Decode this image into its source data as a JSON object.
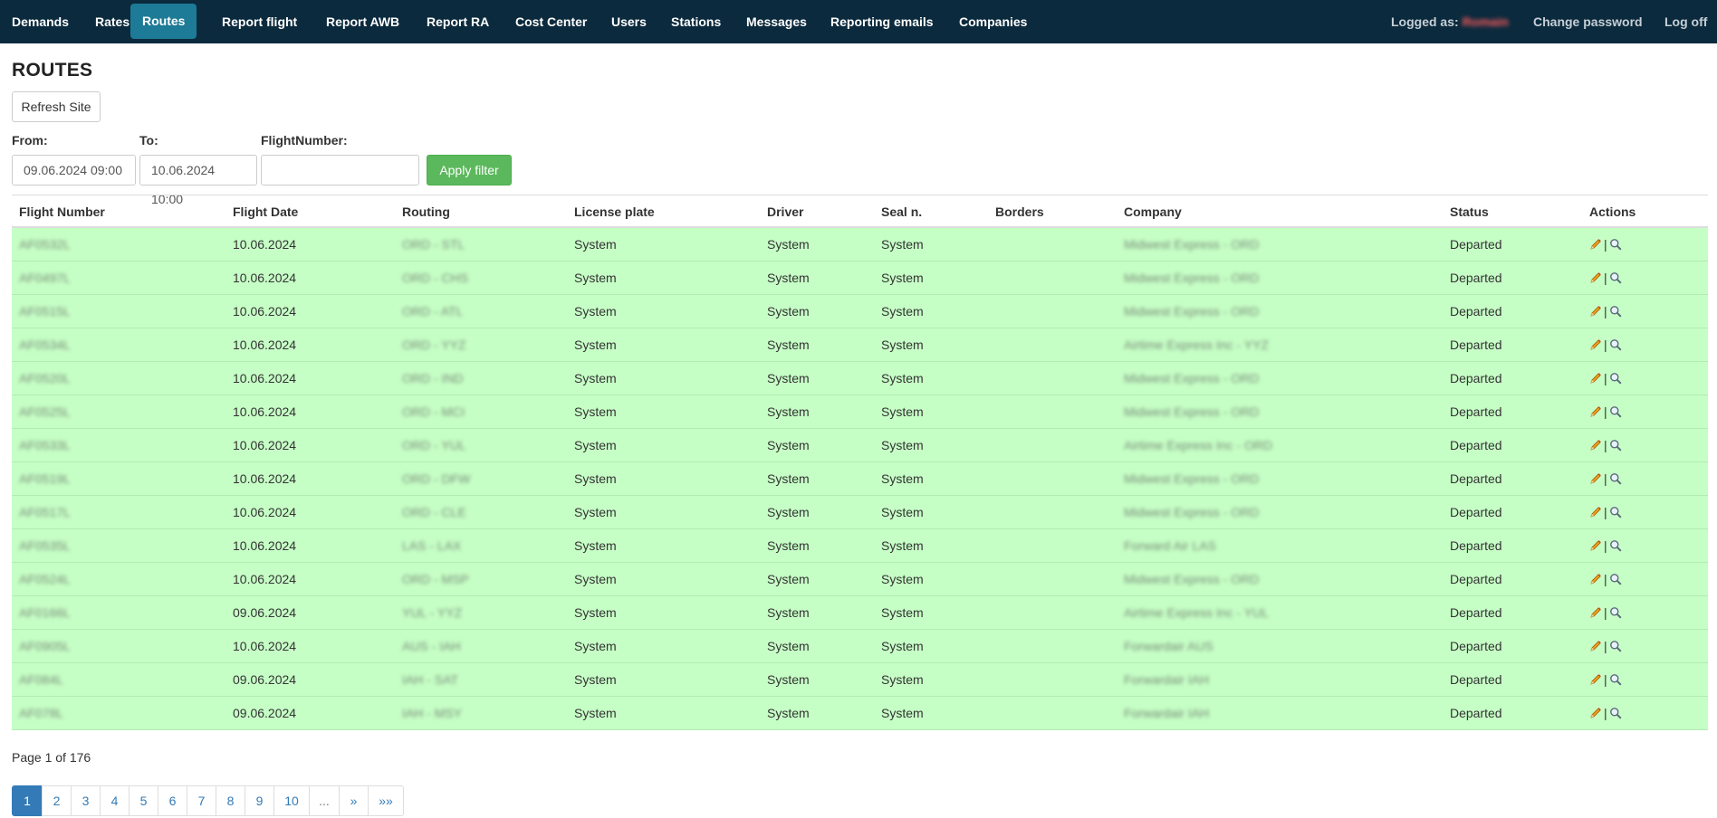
{
  "nav": {
    "items": [
      {
        "label": "Demands"
      },
      {
        "label": "Rates"
      },
      {
        "label": "Routes"
      },
      {
        "label": "Report flight"
      },
      {
        "label": "Report AWB"
      },
      {
        "label": "Report RA"
      },
      {
        "label": "Cost Center"
      },
      {
        "label": "Users"
      },
      {
        "label": "Stations"
      },
      {
        "label": "Messages"
      },
      {
        "label": "Reporting emails"
      },
      {
        "label": "Companies"
      }
    ],
    "active": "Routes",
    "logged_as_label": "Logged as:",
    "logged_user": "Romain",
    "change_password": "Change password",
    "log_off": "Log off"
  },
  "page": {
    "title": "ROUTES",
    "refresh_label": "Refresh Site"
  },
  "filter": {
    "from_label": "From:",
    "from_value": "09.06.2024 09:00",
    "to_label": "To:",
    "to_value": "10.06.2024 10:00",
    "flight_label": "FlightNumber:",
    "flight_value": "",
    "apply_label": "Apply filter"
  },
  "table": {
    "row_color": "#c6ffc6",
    "headers": [
      "Flight Number",
      "Flight Date",
      "Routing",
      "License plate",
      "Driver",
      "Seal n.",
      "Borders",
      "Company",
      "Status",
      "Actions"
    ],
    "rows": [
      {
        "flight": "AF0532L",
        "date": "10.06.2024",
        "routing": "ORD - STL",
        "plate": "System",
        "driver": "System",
        "seal": "System",
        "borders": "",
        "company": "Midwest Express - ORD",
        "status": "Departed"
      },
      {
        "flight": "AF0497L",
        "date": "10.06.2024",
        "routing": "ORD - CHS",
        "plate": "System",
        "driver": "System",
        "seal": "System",
        "borders": "",
        "company": "Midwest Express - ORD",
        "status": "Departed"
      },
      {
        "flight": "AF0515L",
        "date": "10.06.2024",
        "routing": "ORD - ATL",
        "plate": "System",
        "driver": "System",
        "seal": "System",
        "borders": "",
        "company": "Midwest Express - ORD",
        "status": "Departed"
      },
      {
        "flight": "AF0534L",
        "date": "10.06.2024",
        "routing": "ORD - YYZ",
        "plate": "System",
        "driver": "System",
        "seal": "System",
        "borders": "",
        "company": "Airtime Express Inc - YYZ",
        "status": "Departed"
      },
      {
        "flight": "AF0520L",
        "date": "10.06.2024",
        "routing": "ORD - IND",
        "plate": "System",
        "driver": "System",
        "seal": "System",
        "borders": "",
        "company": "Midwest Express - ORD",
        "status": "Departed"
      },
      {
        "flight": "AF0525L",
        "date": "10.06.2024",
        "routing": "ORD - MCI",
        "plate": "System",
        "driver": "System",
        "seal": "System",
        "borders": "",
        "company": "Midwest Express - ORD",
        "status": "Departed"
      },
      {
        "flight": "AF0533L",
        "date": "10.06.2024",
        "routing": "ORD - YUL",
        "plate": "System",
        "driver": "System",
        "seal": "System",
        "borders": "",
        "company": "Airtime Express Inc - ORD",
        "status": "Departed"
      },
      {
        "flight": "AF0519L",
        "date": "10.06.2024",
        "routing": "ORD - DFW",
        "plate": "System",
        "driver": "System",
        "seal": "System",
        "borders": "",
        "company": "Midwest Express - ORD",
        "status": "Departed"
      },
      {
        "flight": "AF0517L",
        "date": "10.06.2024",
        "routing": "ORD - CLE",
        "plate": "System",
        "driver": "System",
        "seal": "System",
        "borders": "",
        "company": "Midwest Express - ORD",
        "status": "Departed"
      },
      {
        "flight": "AF0535L",
        "date": "10.06.2024",
        "routing": "LAS - LAX",
        "plate": "System",
        "driver": "System",
        "seal": "System",
        "borders": "",
        "company": "Forward Air LAS",
        "status": "Departed"
      },
      {
        "flight": "AF0524L",
        "date": "10.06.2024",
        "routing": "ORD - MSP",
        "plate": "System",
        "driver": "System",
        "seal": "System",
        "borders": "",
        "company": "Midwest Express - ORD",
        "status": "Departed"
      },
      {
        "flight": "AF0166L",
        "date": "09.06.2024",
        "routing": "YUL - YYZ",
        "plate": "System",
        "driver": "System",
        "seal": "System",
        "borders": "",
        "company": "Airtime Express Inc - YUL",
        "status": "Departed"
      },
      {
        "flight": "AF0905L",
        "date": "10.06.2024",
        "routing": "AUS - IAH",
        "plate": "System",
        "driver": "System",
        "seal": "System",
        "borders": "",
        "company": "Forwardair AUS",
        "status": "Departed"
      },
      {
        "flight": "AF084L",
        "date": "09.06.2024",
        "routing": "IAH - SAT",
        "plate": "System",
        "driver": "System",
        "seal": "System",
        "borders": "",
        "company": "Forwardair IAH",
        "status": "Departed"
      },
      {
        "flight": "AF078L",
        "date": "09.06.2024",
        "routing": "IAH - MSY",
        "plate": "System",
        "driver": "System",
        "seal": "System",
        "borders": "",
        "company": "Forwardair IAH",
        "status": "Departed"
      }
    ]
  },
  "pagination": {
    "info": "Page 1 of 176",
    "pages": [
      "1",
      "2",
      "3",
      "4",
      "5",
      "6",
      "7",
      "8",
      "9",
      "10",
      "...",
      "»",
      "»»"
    ],
    "current": "1"
  },
  "icons": {
    "edit": "pencil-icon",
    "view": "search-icon"
  }
}
